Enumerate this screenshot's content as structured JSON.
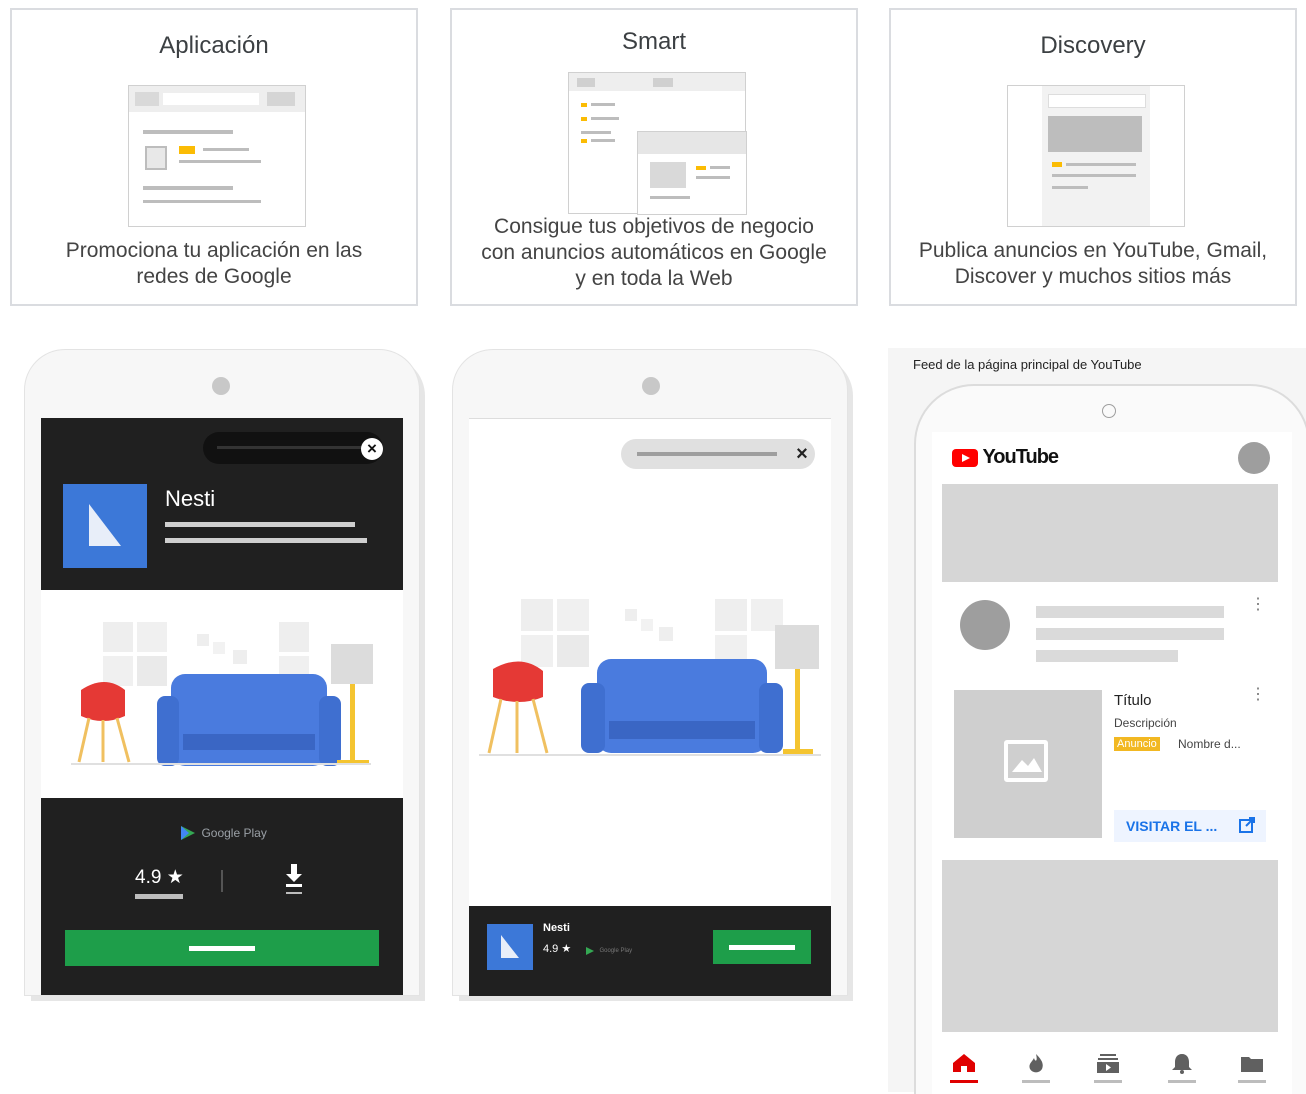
{
  "cards": [
    {
      "title": "Aplicación",
      "description_lines": [
        "Promociona tu aplicación en las",
        "redes de Google"
      ]
    },
    {
      "title": "Smart",
      "description_lines": [
        "Consigue tus objetivos de negocio",
        "con anuncios automáticos en Google",
        "y en toda la Web"
      ]
    },
    {
      "title": "Discovery",
      "description_lines": [
        "Publica anuncios en YouTube, Gmail,",
        "Discover y muchos sitios más"
      ]
    }
  ],
  "app_phone": {
    "app_name": "Nesti",
    "rating": "4.9 ★",
    "store": "Google Play",
    "close_icon": "close-circle-icon",
    "download_icon": "download-icon"
  },
  "smart_phone": {
    "app_name": "Nesti",
    "rating": "4.9 ★",
    "store": "Google Play"
  },
  "youtube": {
    "caption": "Feed de la página principal de YouTube",
    "logo_text": "YouTube",
    "ad_title": "Título",
    "ad_description": "Descripción",
    "ad_badge": "Anuncio",
    "advertiser": "Nombre d...",
    "cta": "VISITAR EL ...",
    "nav_icons": [
      "home-icon",
      "trending-icon",
      "subscriptions-icon",
      "notifications-icon",
      "library-icon"
    ],
    "colors": {
      "youtube_red": "#ff0000",
      "cta_blue": "#1a73e8",
      "badge_yellow": "#f2b822"
    }
  },
  "colors": {
    "accent_blue": "#3c78d8",
    "google_green": "#1e9e4a",
    "dark_panel": "#202020",
    "sofa_blue": "#4a7bde",
    "chair_red": "#e53935",
    "lamp_yellow": "#f4c430"
  }
}
